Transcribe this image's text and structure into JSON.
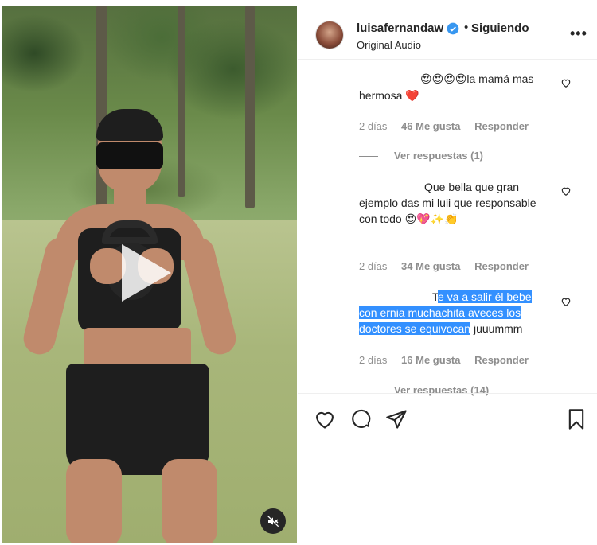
{
  "post": {
    "username": "luisafernandaw",
    "follow_separator": "•",
    "follow_status": "Siguiendo",
    "audio_label": "Original Audio",
    "more_label": "•••"
  },
  "comments": [
    {
      "prefix_emojis": "😍😍😍😍",
      "text": "la mamá mas hermosa",
      "suffix_emoji": "❤️",
      "time": "2 días",
      "likes": "46 Me gusta",
      "reply": "Responder",
      "view_replies": "Ver respuestas (1)"
    },
    {
      "text": "Que bella que gran ejemplo das mi luii que responsable con todo",
      "suffix_emojis": "😍💖✨👏",
      "time": "2 días",
      "likes": "34 Me gusta",
      "reply": "Responder"
    },
    {
      "text_first": "T",
      "text_selected": "e va a salir él bebe con ernia muchachita aveces los doctores se equivocan",
      "text_rest": " juuummm",
      "time": "2 días",
      "likes": "16 Me gusta",
      "reply": "Responder",
      "view_replies": "Ver respuestas (14)"
    }
  ],
  "icons": {
    "verified": "verified-badge-icon",
    "like": "heart-icon",
    "comment": "comment-icon",
    "share": "share-icon",
    "save": "bookmark-icon",
    "play": "play-icon",
    "mute": "muted-speaker-icon"
  },
  "colors": {
    "verified_blue": "#3897f0",
    "selection": "#3390ff",
    "muted_text": "#8e8e8e"
  }
}
